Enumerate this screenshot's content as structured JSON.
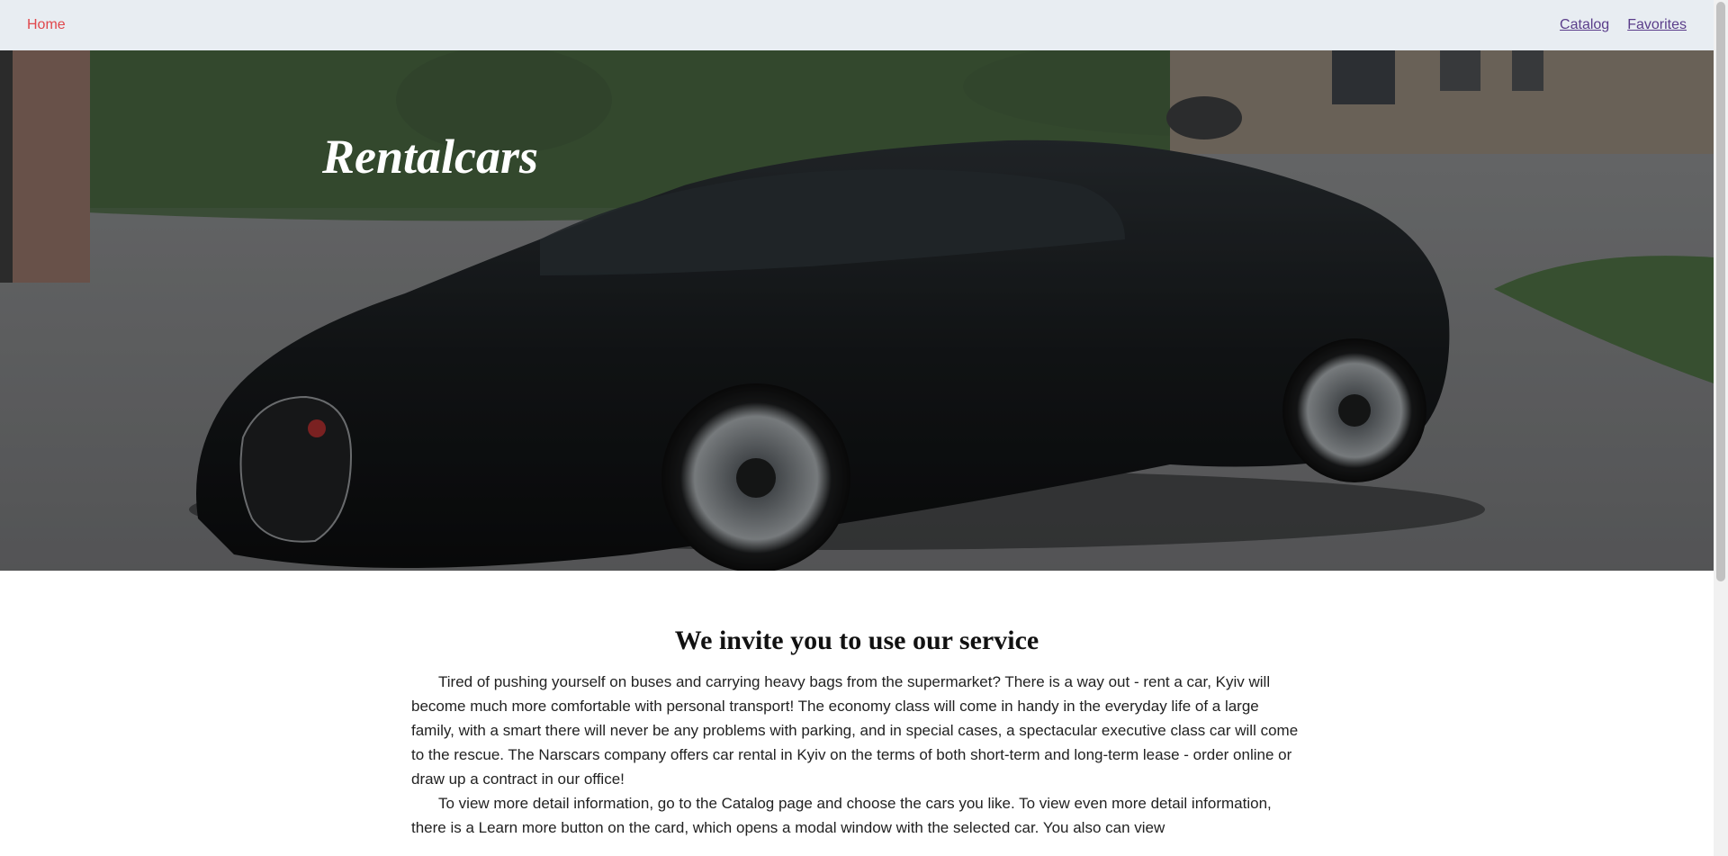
{
  "nav": {
    "home_label": "Home",
    "catalog_label": "Catalog",
    "favorites_label": "Favorites"
  },
  "hero": {
    "title": "Rentalcars",
    "image_subject": "black sports car parked on gravel driveway"
  },
  "main": {
    "section_title": "We invite you to use our service",
    "paragraphs": [
      "Tired of pushing yourself on buses and carrying heavy bags from the supermarket? There is a way out - rent a car, Kyiv will become much more comfortable with personal transport! The economy class will come in handy in the everyday life of a large family, with a smart there will never be any problems with parking, and in special cases, a spectacular executive class car will come to the rescue. The Narscars company offers car rental in Kyiv on the terms of both short-term and long-term lease - order online or draw up a contract in our office!",
      "To view more detail information, go to the Catalog page and choose the cars you like. To view even more detail information, there is a Learn more button on the card, which opens a modal window with the selected car. You also can view"
    ]
  },
  "colors": {
    "nav_bg": "#e8edf2",
    "home_link": "#e0474c",
    "nav_link": "#5a3d8a"
  }
}
